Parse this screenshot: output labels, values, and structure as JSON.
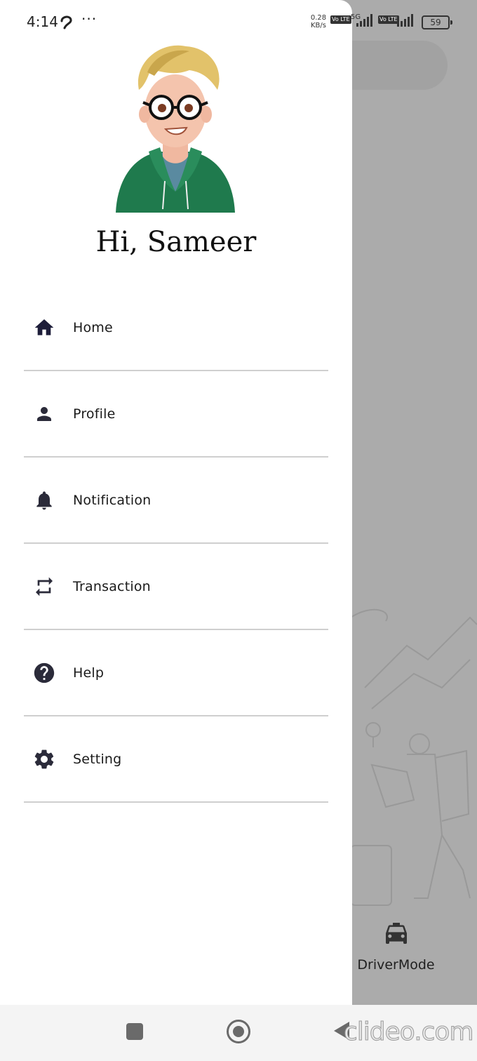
{
  "status_bar": {
    "time": "4:14",
    "more": "···",
    "net_speed_value": "0.28",
    "net_speed_unit": "KB/s",
    "network_type": "5G",
    "volte_label": "Vo LTE",
    "battery": "59"
  },
  "drawer": {
    "greeting": "Hi, Sameer",
    "menu": [
      {
        "label": "Home",
        "icon": "home-icon"
      },
      {
        "label": "Profile",
        "icon": "person-icon"
      },
      {
        "label": "Notification",
        "icon": "bell-icon"
      },
      {
        "label": "Transaction",
        "icon": "swap-arrows-icon"
      },
      {
        "label": "Help",
        "icon": "help-icon"
      },
      {
        "label": "Setting",
        "icon": "gear-icon"
      }
    ]
  },
  "background": {
    "driver_mode_label": "DriverMode",
    "driver_mode_icon": "taxi-icon"
  },
  "watermark": "clideo.com",
  "colors": {
    "drawer_bg": "#ffffff",
    "scrim": "#ababab",
    "icon_dark": "#2b2b3a",
    "divider": "#cfcfcf"
  }
}
